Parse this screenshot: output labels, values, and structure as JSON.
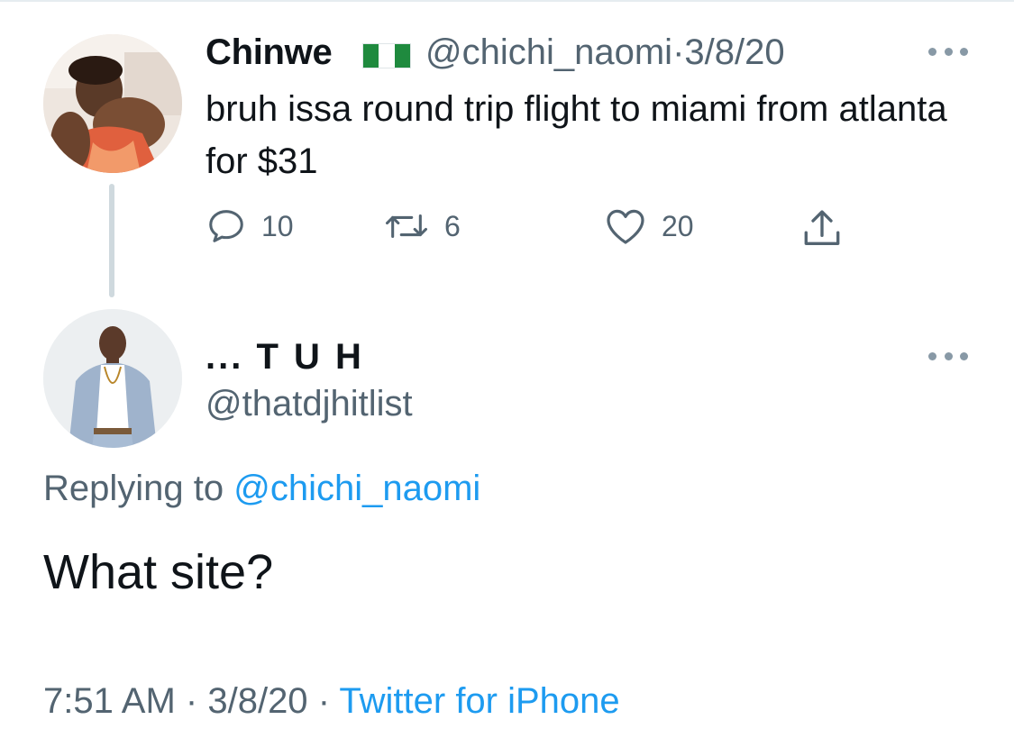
{
  "colors": {
    "text": "#0f1419",
    "secondary": "#536471",
    "link": "#1d9bf0",
    "thread_line": "#cfd9de",
    "icon": "#536471"
  },
  "parent_tweet": {
    "display_name": "Chinwe",
    "flag_icon": "nigeria-flag-icon",
    "handle": "@chichi_naomi",
    "separator": "·",
    "date": "3/8/20",
    "text": "bruh issa round trip flight to miami from atlanta for $31",
    "actions": {
      "replies": "10",
      "retweets": "6",
      "likes": "20"
    }
  },
  "reply_tweet": {
    "display_name": "... T U H",
    "handle": "@thatdjhitlist",
    "replying_prefix": "Replying to",
    "replying_to": "@chichi_naomi",
    "text": "What site?",
    "time": "7:51 AM",
    "separator": "·",
    "date": "3/8/20",
    "client": "Twitter for iPhone"
  }
}
